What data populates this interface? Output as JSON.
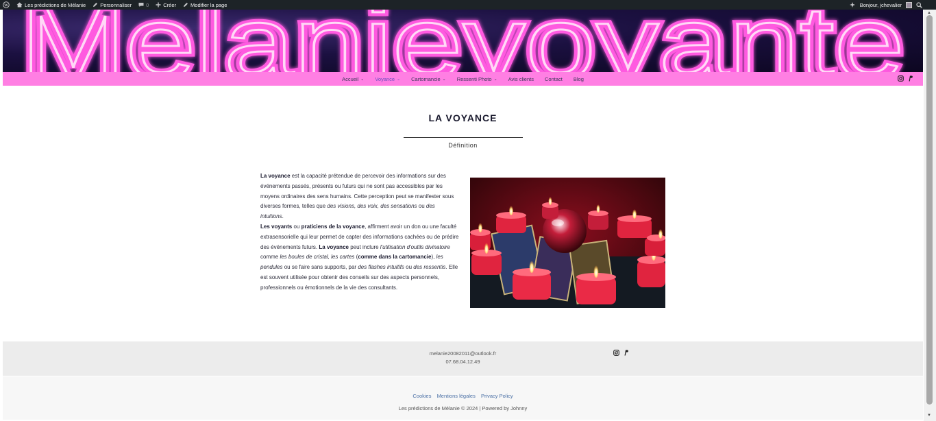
{
  "adminbar": {
    "site_name": "Les prédictions de Mélanie",
    "customize": "Personnaliser",
    "comments_count": "0",
    "create": "Créer",
    "edit_page": "Modifier la page",
    "greeting": "Bonjour, jchevalier"
  },
  "banner": {
    "logo_text": "Melanievoyante"
  },
  "nav": {
    "items": [
      {
        "label": "Accueil"
      },
      {
        "label": "Voyance"
      },
      {
        "label": "Cartomancie"
      },
      {
        "label": "Ressenti Photo"
      },
      {
        "label": "Avis clients"
      },
      {
        "label": "Contact"
      },
      {
        "label": "Blog"
      }
    ]
  },
  "main": {
    "title": "LA VOYANCE",
    "subtitle": "Définition",
    "p1_b1": "La voyance",
    "p1_t1": " est la capacité prétendue de percevoir des informations sur des événements passés, présents ou futurs qui ne sont pas accessibles par les moyens ordinaires des sens humains. Cette perception peut se manifester sous diverses formes, telles que ",
    "p1_i1": "des visions, des voix, des sensations",
    "p1_t2": " ou ",
    "p1_i2": "des intuitions",
    "p1_t3": ".",
    "p2_b1": "Les voyants",
    "p2_t1": " ou ",
    "p2_b2": "praticiens de la voyance",
    "p2_t2": ", affirment avoir un don ou une faculté extrasensorielle qui leur permet de capter des informations cachées ou de prédire des événements futurs. ",
    "p2_b3": "La voyance",
    "p2_t3": " peut inclure ",
    "p2_i1": "l'utilisation d'outils divinatoire",
    "p2_t4": " comme ",
    "p2_i2": "les boules de cristal, les cartes",
    "p2_t5": " (",
    "p2_b4": "comme dans la cartomancie",
    "p2_t6": "), ",
    "p2_i3": "les pendules",
    "p2_t7": " ou se faire sans supports, par ",
    "p2_i4": "des flashes intuitifs",
    "p2_t8": " ou ",
    "p2_i5": "des ressentis",
    "p2_t9": ". Elle est souvent utilisée pour obtenir des conseils sur des aspects personnels, professionnels ou émotionnels de la vie des consultants."
  },
  "footer": {
    "email": "melanie20082011@outlook.fr",
    "phone": "07.68.04.12.49",
    "links": [
      "Cookies",
      "Mentions légales",
      "Privacy Policy"
    ],
    "copyright": "Les prédictions de Mélanie © 2024 | Powered by Johnny"
  },
  "colors": {
    "nav_bg": "#ff7fe3",
    "adminbar_bg": "#1d2327",
    "neon": "#ff5ae0"
  },
  "icons": [
    "wordpress-icon",
    "home-icon",
    "pencil-icon",
    "comment-icon",
    "plus-icon",
    "ai-sparkle-icon",
    "search-icon",
    "instagram-icon",
    "paypal-icon"
  ]
}
